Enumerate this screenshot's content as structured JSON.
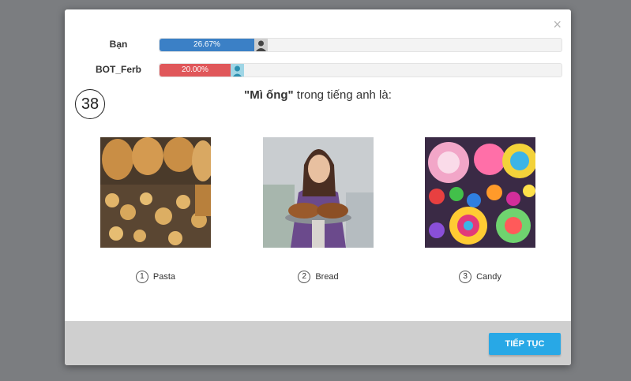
{
  "players": [
    {
      "name": "Bạn",
      "percent_label": "26.67%",
      "progress": 0.2667,
      "color": "#3b80c6"
    },
    {
      "name": "BOT_Ferb",
      "percent_label": "20.00%",
      "progress": 0.2,
      "color": "#e0575a"
    }
  ],
  "timer": "38",
  "question": {
    "quoted": "\"Mì ống\"",
    "rest": " trong tiếng anh là:"
  },
  "options": [
    {
      "number": "1",
      "label": "Pasta",
      "image": "pasta-photo"
    },
    {
      "number": "2",
      "label": "Bread",
      "image": "bread-photo"
    },
    {
      "number": "3",
      "label": "Candy",
      "image": "candy-photo"
    }
  ],
  "close_icon": "×",
  "continue_label": "TIẾP TỤC",
  "colors": {
    "accent": "#28a8e6",
    "overlay": "#7b7d80",
    "footer": "#cfcfcf"
  }
}
